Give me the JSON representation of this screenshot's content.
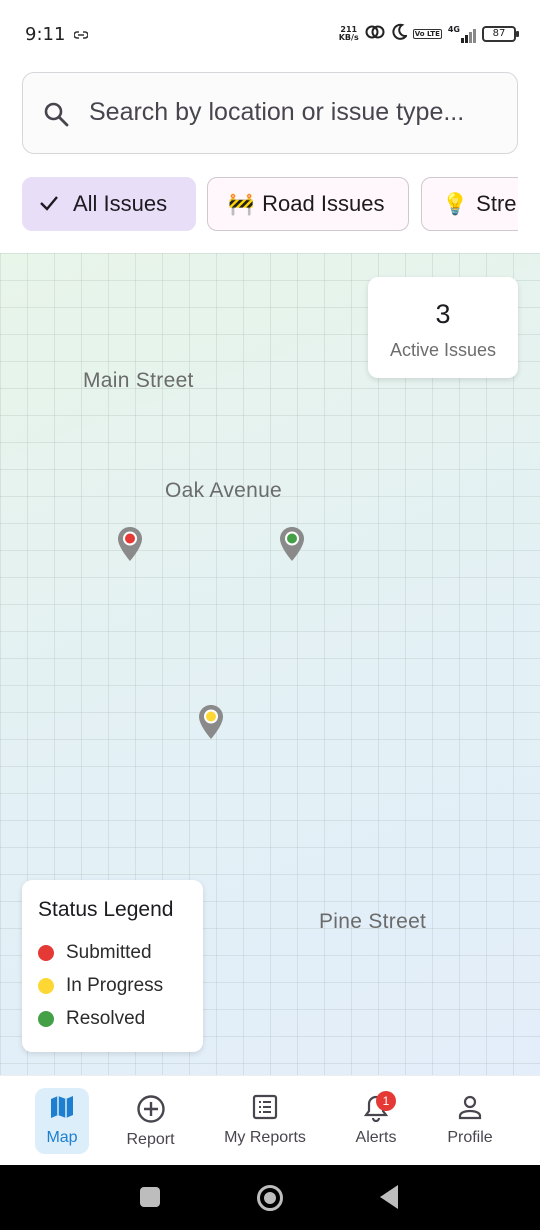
{
  "status_bar": {
    "time": "9:11",
    "speed_value": "211",
    "speed_unit": "KB/s",
    "network": "4G",
    "volte": "Vo LTE",
    "battery": "87"
  },
  "search": {
    "placeholder": "Search by location or issue type..."
  },
  "filters": [
    {
      "label": "All Issues",
      "selected": true,
      "icon": "check-icon"
    },
    {
      "label": "Road Issues",
      "selected": false,
      "emoji": "🚧"
    },
    {
      "label": "Stre",
      "selected": false,
      "emoji": "💡"
    }
  ],
  "map": {
    "streets": [
      "Main Street",
      "Oak Avenue",
      "Pine Street"
    ],
    "active_issues": {
      "count": "3",
      "label": "Active Issues"
    },
    "pins": [
      {
        "status": "submitted",
        "color": "#e53935"
      },
      {
        "status": "resolved",
        "color": "#43a047"
      },
      {
        "status": "in-progress",
        "color": "#fdd835"
      }
    ],
    "legend": {
      "title": "Status Legend",
      "items": [
        {
          "label": "Submitted",
          "color": "#e53935"
        },
        {
          "label": "In Progress",
          "color": "#fdd835"
        },
        {
          "label": "Resolved",
          "color": "#43a047"
        }
      ]
    }
  },
  "bottom_nav": {
    "items": [
      {
        "label": "Map",
        "icon": "map-icon",
        "active": true
      },
      {
        "label": "Report",
        "icon": "plus-circle-icon"
      },
      {
        "label": "My Reports",
        "icon": "list-icon"
      },
      {
        "label": "Alerts",
        "icon": "bell-icon",
        "badge": "1"
      },
      {
        "label": "Profile",
        "icon": "person-icon"
      }
    ]
  },
  "colors": {
    "accent": "#1e7fd1",
    "chip_selected": "#e8def8",
    "pin_body": "#8a8a8a"
  }
}
